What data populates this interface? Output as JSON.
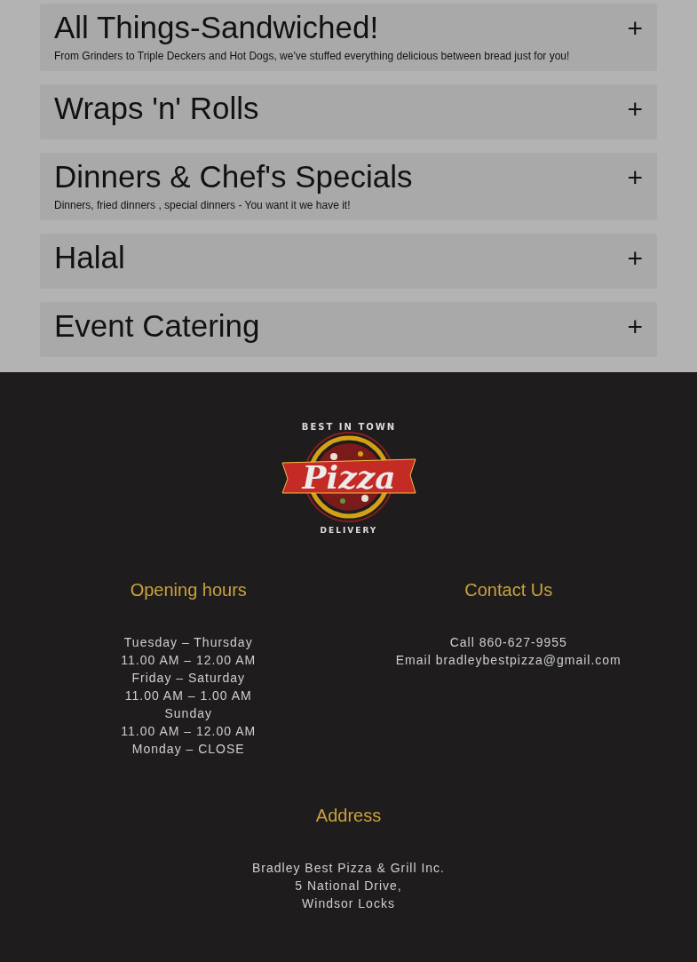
{
  "menu_sections": [
    {
      "title": "All Things-Sandwiched!",
      "description": "From Grinders to Triple Deckers and Hot Dogs, we've stuffed everything delicious between bread just for you!",
      "expanded": false,
      "toggle": "+"
    },
    {
      "title": "Wraps 'n' Rolls",
      "expanded": false,
      "toggle": "+"
    },
    {
      "title": "Dinners & Chef's Specials",
      "description": "Dinners, fried dinners , special dinners - You want it we have it!",
      "expanded": false,
      "toggle": "+"
    },
    {
      "title": "Halal",
      "expanded": false,
      "toggle": "+"
    },
    {
      "title": "Event Catering",
      "expanded": false,
      "toggle": "+"
    }
  ],
  "footer": {
    "logo": {
      "top": "BEST IN TOWN",
      "main": "Pizza",
      "bottom": "DELIVERY"
    },
    "opening_hours": {
      "heading": "Opening hours",
      "lines": [
        "Tuesday – Thursday",
        "11.00 AM – 12.00 AM",
        "Friday – Saturday",
        "11.00 AM – 1.00 AM",
        "Sunday",
        "11.00 AM – 12.00 AM",
        "Monday – CLOSE"
      ]
    },
    "contact": {
      "heading": "Contact Us",
      "lines": [
        "Call 860-627-9955",
        "Email bradleybestpizza@gmail.com"
      ]
    },
    "address": {
      "heading": "Address",
      "lines": [
        "Bradley Best Pizza & Grill Inc.",
        "5 National Drive,",
        "Windsor Locks"
      ]
    }
  }
}
